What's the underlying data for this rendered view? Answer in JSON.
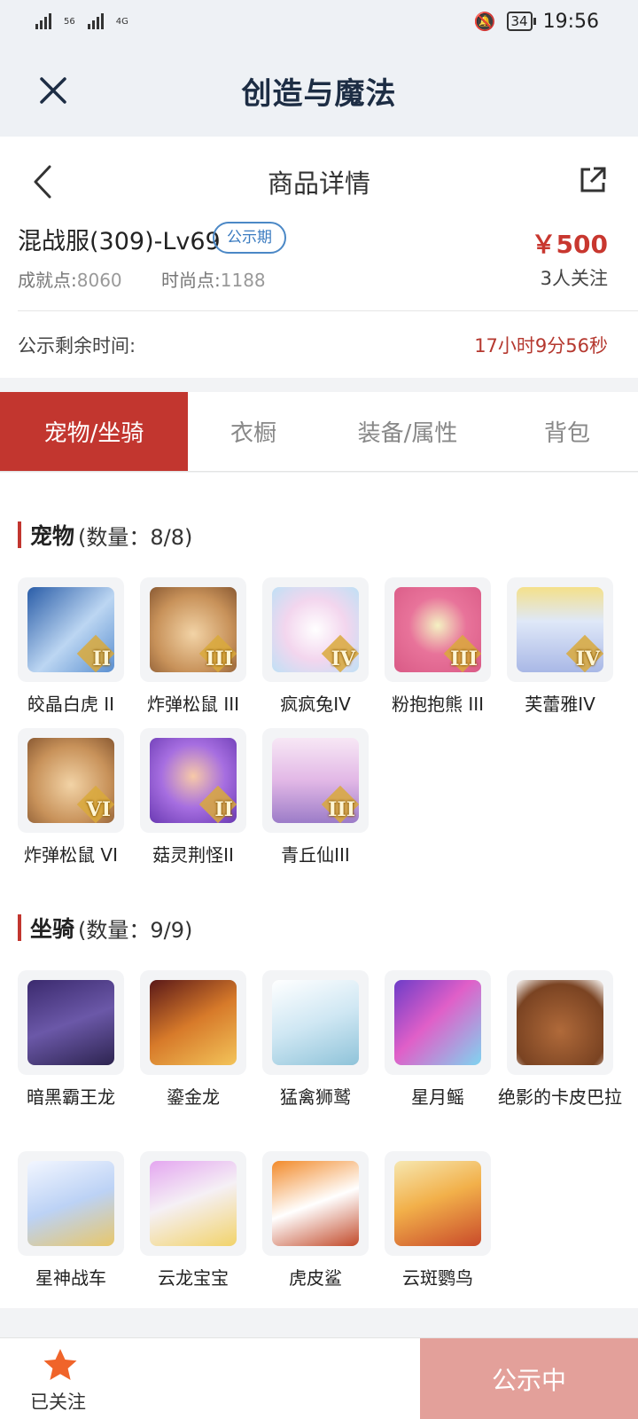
{
  "status_bar": {
    "net1": "56",
    "net2": "4G",
    "battery": "34",
    "time": "19:56"
  },
  "app": {
    "title": "创造与魔法"
  },
  "header": {
    "title": "商品详情"
  },
  "product": {
    "name": "混战服(309)-Lv69",
    "badge": "公示期",
    "price": "￥500",
    "followers": "3人关注",
    "achievement_label": "成就点:",
    "achievement_value": "8060",
    "fashion_label": "时尚点:",
    "fashion_value": "1188",
    "remain_label": "公示剩余时间:",
    "remain_value": "17小时9分56秒"
  },
  "tabs": [
    {
      "label": "宠物/坐骑",
      "active": true
    },
    {
      "label": "衣橱",
      "active": false
    },
    {
      "label": "装备/属性",
      "active": false
    },
    {
      "label": "背包",
      "active": false
    }
  ],
  "pets": {
    "title": "宠物",
    "count": "(数量：8/8)",
    "items": [
      {
        "label": "皎晶白虎 II",
        "rank": "II",
        "icon": "white-tiger"
      },
      {
        "label": "炸弹松鼠 III",
        "rank": "III",
        "icon": "bomb-squirrel"
      },
      {
        "label": "疯疯兔IV",
        "rank": "IV",
        "icon": "crazy-rabbit"
      },
      {
        "label": "粉抱抱熊 III",
        "rank": "III",
        "icon": "pink-bear"
      },
      {
        "label": "芙蕾雅IV",
        "rank": "IV",
        "icon": "freya"
      },
      {
        "label": "炸弹松鼠 VI",
        "rank": "VI",
        "icon": "bomb-squirrel"
      },
      {
        "label": "菇灵荆怪II",
        "rank": "II",
        "icon": "mushroom-sprite"
      },
      {
        "label": "青丘仙III",
        "rank": "III",
        "icon": "fox-fairy"
      }
    ]
  },
  "mounts": {
    "title": "坐骑",
    "count": "(数量：9/9)",
    "items": [
      {
        "label": "暗黑霸王龙",
        "icon": "dark-trex"
      },
      {
        "label": "鎏金龙",
        "icon": "gilded-dragon"
      },
      {
        "label": "猛禽狮鹫",
        "icon": "griffin"
      },
      {
        "label": "星月鳐",
        "icon": "star-ray"
      },
      {
        "label": "绝影的卡皮巴拉",
        "icon": "capybara"
      },
      {
        "label": "星神战车",
        "icon": "star-chariot"
      },
      {
        "label": "云龙宝宝",
        "icon": "cloud-dragon-baby"
      },
      {
        "label": "虎皮鲨",
        "icon": "tiger-shark"
      },
      {
        "label": "云斑鹦鸟",
        "icon": "cloud-parrot"
      }
    ]
  },
  "bottom": {
    "fav_label": "已关注",
    "status_label": "公示中"
  },
  "colors": {
    "accent": "#c2362f",
    "price": "#c8372f",
    "badge": "#3a7bc0",
    "status_button": "#e3a09a"
  }
}
